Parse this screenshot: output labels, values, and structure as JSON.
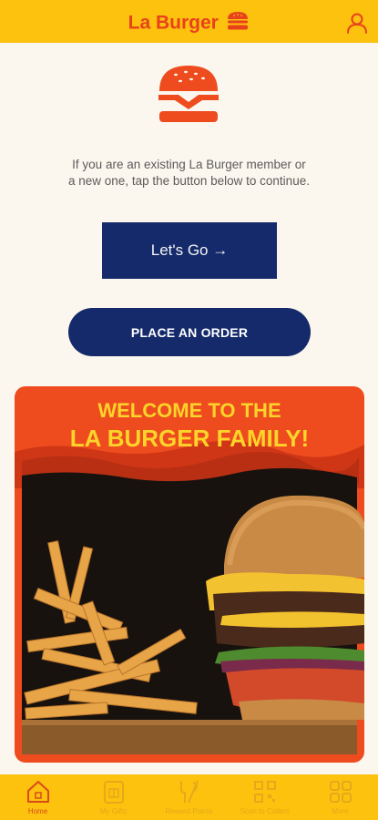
{
  "header": {
    "brand": "La Burger",
    "logo_icon": "burger-icon",
    "profile_icon": "user-icon"
  },
  "main": {
    "hero_icon": "burger-icon",
    "intro_text": "If you are an existing La Burger member or a new one, tap the button below to continue.",
    "lets_go_label": "Let's Go →",
    "order_label": "PLACE AN ORDER"
  },
  "promo": {
    "title_line1": "WELCOME TO THE",
    "title_line2": "LA BURGER FAMILY!"
  },
  "tabs": [
    {
      "label": "Home",
      "icon": "home-icon",
      "active": true
    },
    {
      "label": "My Gifts",
      "icon": "gift-icon",
      "active": false
    },
    {
      "label": "Reward Points",
      "icon": "rewards-icon",
      "active": false
    },
    {
      "label": "Scan to Collect",
      "icon": "qr-icon",
      "active": false
    },
    {
      "label": "More",
      "icon": "grid-icon",
      "active": false
    }
  ],
  "colors": {
    "header_bg": "#fcc20e",
    "brand_red": "#e8421c",
    "navy": "#152a6b",
    "cream": "#fcf7ee",
    "promo_orange": "#ee4b1f",
    "promo_yellow": "#fdd42a"
  }
}
